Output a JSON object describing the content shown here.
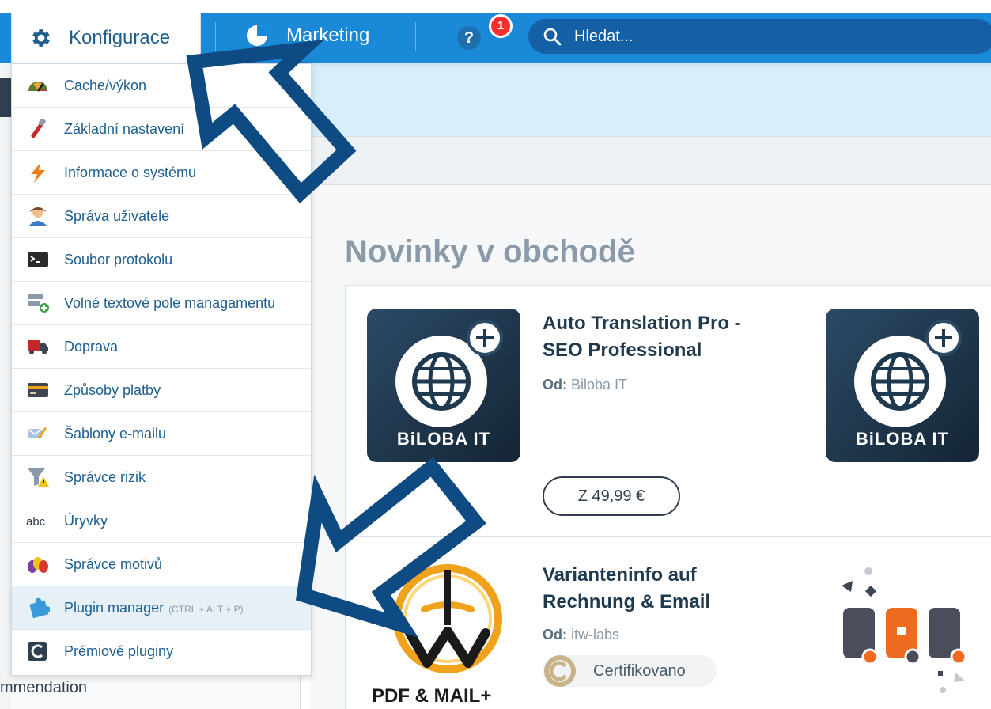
{
  "header": {
    "active_tab": "Konfigurace",
    "marketing_tab": "Marketing",
    "help_icon": "question-icon",
    "notification_count": "1",
    "search_placeholder": "Hledat..."
  },
  "config_menu": {
    "items": [
      {
        "label": "Cache/výkon",
        "icon": "speedometer-icon"
      },
      {
        "label": "Základní nastavení",
        "icon": "wrench-icon"
      },
      {
        "label": "Informace o systému",
        "icon": "lightning-icon"
      },
      {
        "label": "Správa uživatele",
        "icon": "user-icon"
      },
      {
        "label": "Soubor protokolu",
        "icon": "terminal-icon"
      },
      {
        "label": "Volné textové pole managamentu",
        "icon": "textfield-add-icon"
      },
      {
        "label": "Doprava",
        "icon": "truck-icon"
      },
      {
        "label": "Způsoby platby",
        "icon": "credit-card-icon"
      },
      {
        "label": "Šablony e-mailu",
        "icon": "email-template-icon"
      },
      {
        "label": "Správce rizik",
        "icon": "funnel-warning-icon"
      },
      {
        "label": "Úryvky",
        "icon": "abc-icon"
      },
      {
        "label": "Správce motivů",
        "icon": "paint-drops-icon"
      },
      {
        "label": "Plugin manager",
        "shortcut": "(CTRL + ALT + P)",
        "icon": "puzzle-icon"
      },
      {
        "label": "Prémiové pluginy",
        "icon": "shopware-icon"
      }
    ]
  },
  "left_panel": {
    "truncated_text": "mmendation"
  },
  "store": {
    "heading": "Novinky v obchodě",
    "plugins": [
      {
        "title_line1": "Auto Translation Pro -",
        "title_line2": "SEO Professional",
        "by_label": "Od:",
        "vendor": "Biloba IT",
        "brand": "BiLOBA IT",
        "price": "Z 49,99 €"
      },
      {
        "brand": "BiLOBA IT"
      },
      {
        "title_line1": "Varianteninfo auf",
        "title_line2": "Rechnung & Email",
        "by_label": "Od:",
        "vendor": "itw-labs",
        "badge": "Certifikovano",
        "logo_label": "PDF & MAIL+"
      }
    ]
  },
  "colors": {
    "header_blue": "#1a89d8",
    "search_blue": "#1560a5",
    "menu_text": "#1e5f8f",
    "arrow_navy": "#0e4b82",
    "notification_red": "#ff2d2d"
  }
}
